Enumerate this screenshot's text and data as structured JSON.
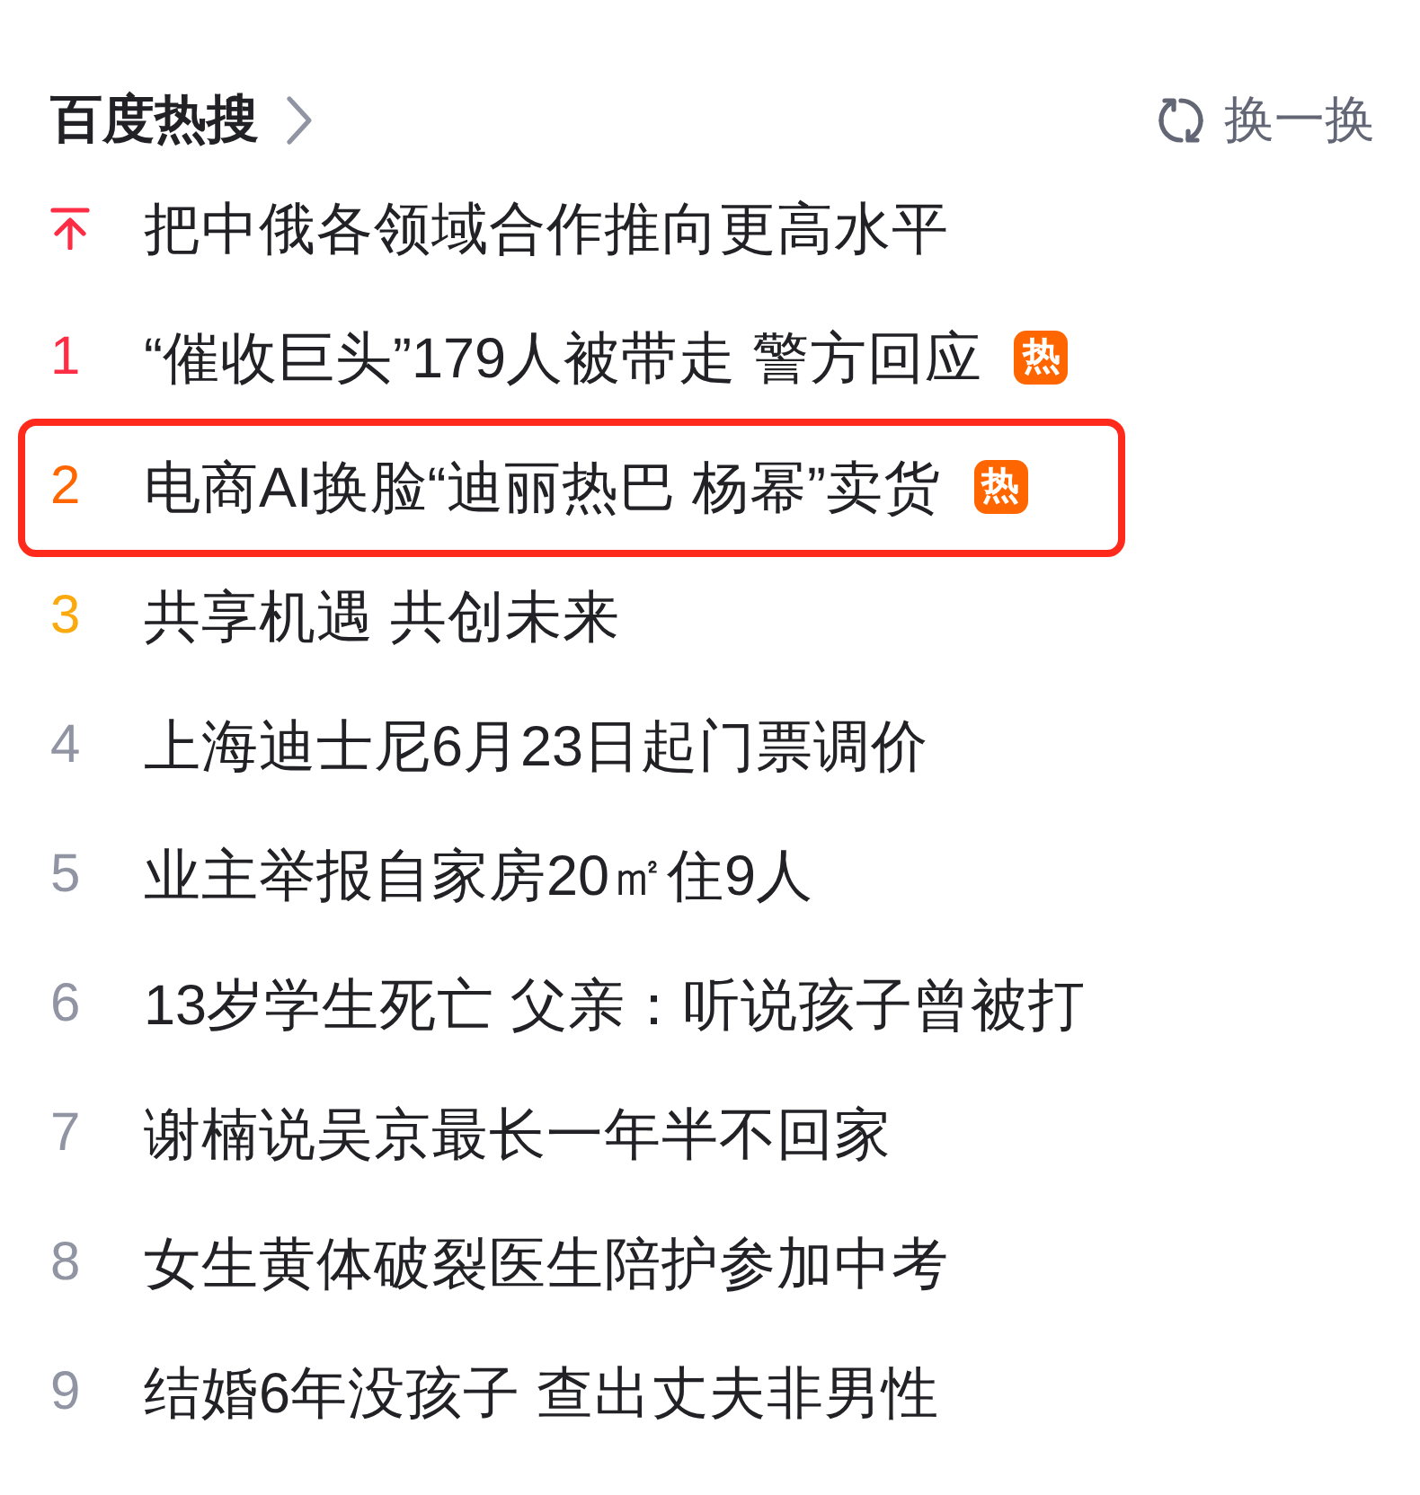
{
  "header": {
    "title": "百度热搜",
    "refresh_label": "换一换"
  },
  "items": [
    {
      "kind": "pinned",
      "color": "#fe2d46",
      "title": "把中俄各领域合作推向更高水平",
      "highlighted": false
    },
    {
      "kind": "ranked",
      "rank": "1",
      "color": "#fe2d46",
      "title": "“催收巨头”179人被带走 警方回应",
      "badge": "热",
      "highlighted": false
    },
    {
      "kind": "ranked",
      "rank": "2",
      "color": "#ff6600",
      "title": "电商AI换脸“迪丽热巴 杨幂”卖货",
      "badge": "热",
      "highlighted": true
    },
    {
      "kind": "ranked",
      "rank": "3",
      "color": "#faa90e",
      "title": "共享机遇 共创未来",
      "highlighted": false
    },
    {
      "kind": "ranked",
      "rank": "4",
      "color": "#9195a3",
      "title": "上海迪士尼6月23日起门票调价",
      "highlighted": false
    },
    {
      "kind": "ranked",
      "rank": "5",
      "color": "#9195a3",
      "title": "业主举报自家房20㎡住9人",
      "highlighted": false
    },
    {
      "kind": "ranked",
      "rank": "6",
      "color": "#9195a3",
      "title": "13岁学生死亡 父亲：听说孩子曾被打",
      "highlighted": false
    },
    {
      "kind": "ranked",
      "rank": "7",
      "color": "#9195a3",
      "title": "谢楠说吴京最长一年半不回家",
      "highlighted": false
    },
    {
      "kind": "ranked",
      "rank": "8",
      "color": "#9195a3",
      "title": "女生黄体破裂医生陪护参加中考",
      "highlighted": false
    },
    {
      "kind": "ranked",
      "rank": "9",
      "color": "#9195a3",
      "title": "结婚6年没孩子 查出丈夫非男性",
      "highlighted": false
    }
  ]
}
